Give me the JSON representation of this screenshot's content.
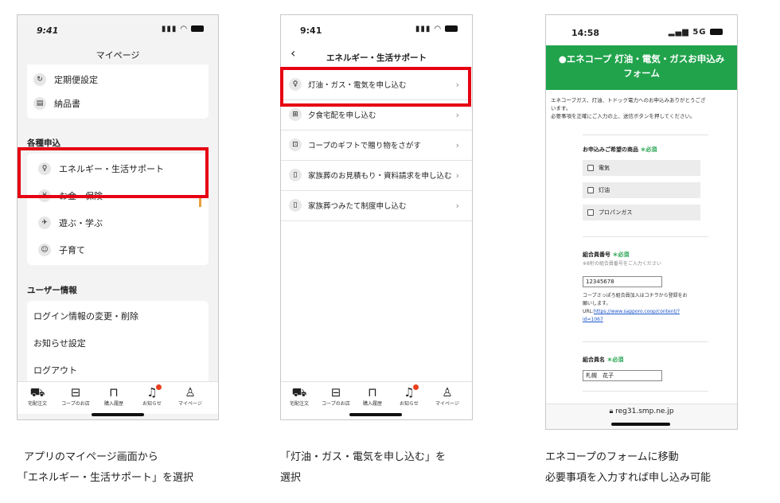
{
  "colors": {
    "accent_red": "#e60012",
    "coop_green": "#21a34c",
    "badge_orange": "#e8401c"
  },
  "screen1": {
    "time": "9:41",
    "title": "マイページ",
    "items_top": [
      {
        "label": "定期便設定",
        "icon": "refresh-icon"
      },
      {
        "label": "納品書",
        "icon": "receipt-icon"
      }
    ],
    "section_apply": "各種申込",
    "items_apply": [
      {
        "label": "エネルギー・生活サポート",
        "icon": "lightbulb-icon"
      },
      {
        "label": "お金・保険",
        "icon": "money-icon"
      },
      {
        "label": "遊ぶ・学ぶ",
        "icon": "plane-icon"
      },
      {
        "label": "子育て",
        "icon": "baby-icon"
      }
    ],
    "section_user": "ユーザー情報",
    "items_user": [
      "ログイン情報の変更・削除",
      "お知らせ設定",
      "ログアウト"
    ]
  },
  "tabbar": [
    "宅配注文",
    "コープのお店",
    "購入履歴",
    "お知らせ",
    "マイページ"
  ],
  "screen2": {
    "time": "9:41",
    "title": "エネルギー・生活サポート",
    "items": [
      {
        "label": "灯油・ガス・電気を申し込む",
        "icon": "lightbulb-icon"
      },
      {
        "label": "夕食宅配を申し込む",
        "icon": "bento-icon"
      },
      {
        "label": "コープのギフトで贈り物をさがす",
        "icon": "gift-icon"
      },
      {
        "label": "家族葬のお見積もり・資料請求を申し込む",
        "icon": "document-icon"
      },
      {
        "label": "家族葬つみたて制度申し込む",
        "icon": "document-icon"
      }
    ]
  },
  "screen3": {
    "time": "14:58",
    "signal": "5G",
    "form_title_1": "●エネコープ 灯油・電気・ガスお申込み",
    "form_title_2": "フォーム",
    "intro_1": "エネコープガス、灯油、トドック電力へのお申込みありがとうござ",
    "intro_2": "います。",
    "intro_3": "必要事項を正確にご入力の上、送信ボタンを押してください。",
    "product_label": "お申込みご希望の商品",
    "required": "＊必須",
    "options": [
      "電気",
      "灯油",
      "プロパンガス"
    ],
    "member_no_label": "組合員番号",
    "member_no_hint": "※8桁の組合員番号をご入力ください",
    "member_no_value": "12345678",
    "member_note_1": "コープさっぽろ組合員加入はコチラから登録をお",
    "member_note_2": "願いします。",
    "member_url_prefix": "URL:",
    "member_url_1": "https://www.sapporo.coop/content/?",
    "member_url_2": "id=1067",
    "name_label": "組合員名",
    "name_value": "札幌　花子",
    "url_bar": "reg31.smp.ne.jp"
  },
  "captions": {
    "c1_line1": "アプリのマイページ画面から",
    "c1_line2": "「エネルギー・生活サポート」を選択",
    "c2_line1": "「灯油・ガス・電気を申し込む」を",
    "c2_line2": "選択",
    "c3_line1": "エネコープのフォームに移動",
    "c3_line2": "必要事項を入力すれば申し込み可能"
  }
}
